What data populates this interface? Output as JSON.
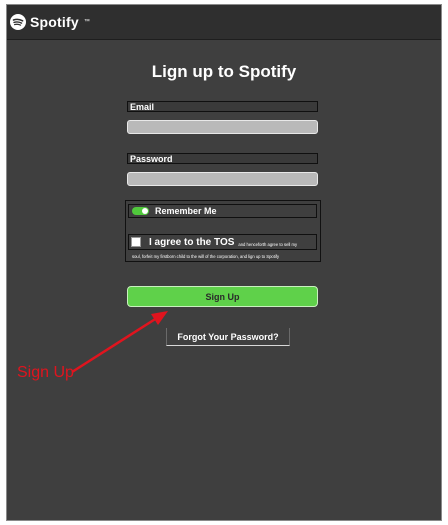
{
  "app": {
    "logo_text": "Spotify",
    "logo_tm": "™"
  },
  "form": {
    "title": "Lign up to Spotify",
    "email_label": "Email",
    "email_value": "",
    "password_label": "Password",
    "password_value": "",
    "remember_label": "Remember Me",
    "remember_on": true,
    "tos_label": "I agree to the TOS",
    "tos_fine_1": "and henceforth agree to sell my",
    "tos_fine_2": "soul, forfeit my firstborn child to the will of the corporation, and lign up to Spotify",
    "tos_checked": false,
    "signup_label": "Sign Up",
    "forgot_label": "Forgot Your Password?"
  },
  "annotation": {
    "text": "Sign Up",
    "color": "#e0141e"
  },
  "colors": {
    "accent": "#5fd14a",
    "background": "#3f3f3f",
    "header": "#2f2f2f"
  },
  "icons": {
    "logo": "spotify-logo-icon",
    "toggle": "toggle-icon",
    "checkbox": "checkbox-icon"
  }
}
